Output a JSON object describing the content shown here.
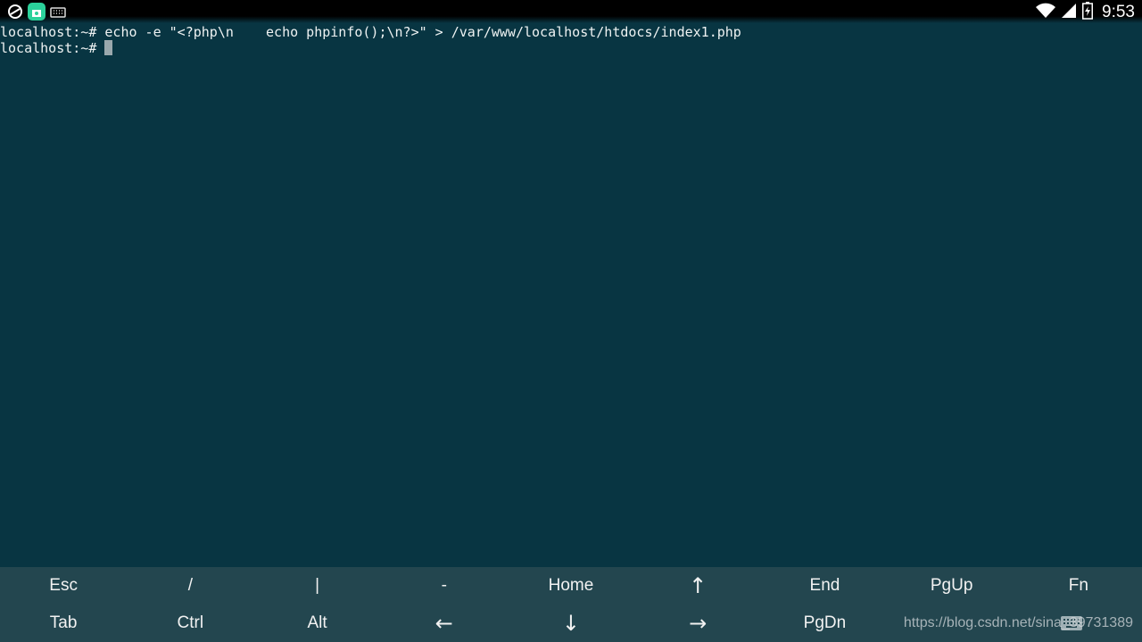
{
  "status_bar": {
    "time": "9:53",
    "left_icons": [
      "sync-icon",
      "app-notification-icon",
      "keyboard-icon"
    ],
    "right_icons": [
      "wifi-icon",
      "signal-icon",
      "battery-icon"
    ]
  },
  "terminal": {
    "lines": [
      "localhost:~# echo -e \"<?php\\n    echo phpinfo();\\n?>\" > /var/www/localhost/htdocs/index1.php",
      "localhost:~# "
    ]
  },
  "extra_keys": {
    "row1": [
      "Esc",
      "/",
      "|",
      "-",
      "Home",
      "↑",
      "End",
      "PgUp",
      "Fn"
    ],
    "row2": [
      "Tab",
      "Ctrl",
      "Alt",
      "←",
      "↓",
      "→",
      "PgDn",
      "",
      ""
    ]
  },
  "watermark": "https://blog.csdn.net/sina_39731389"
}
